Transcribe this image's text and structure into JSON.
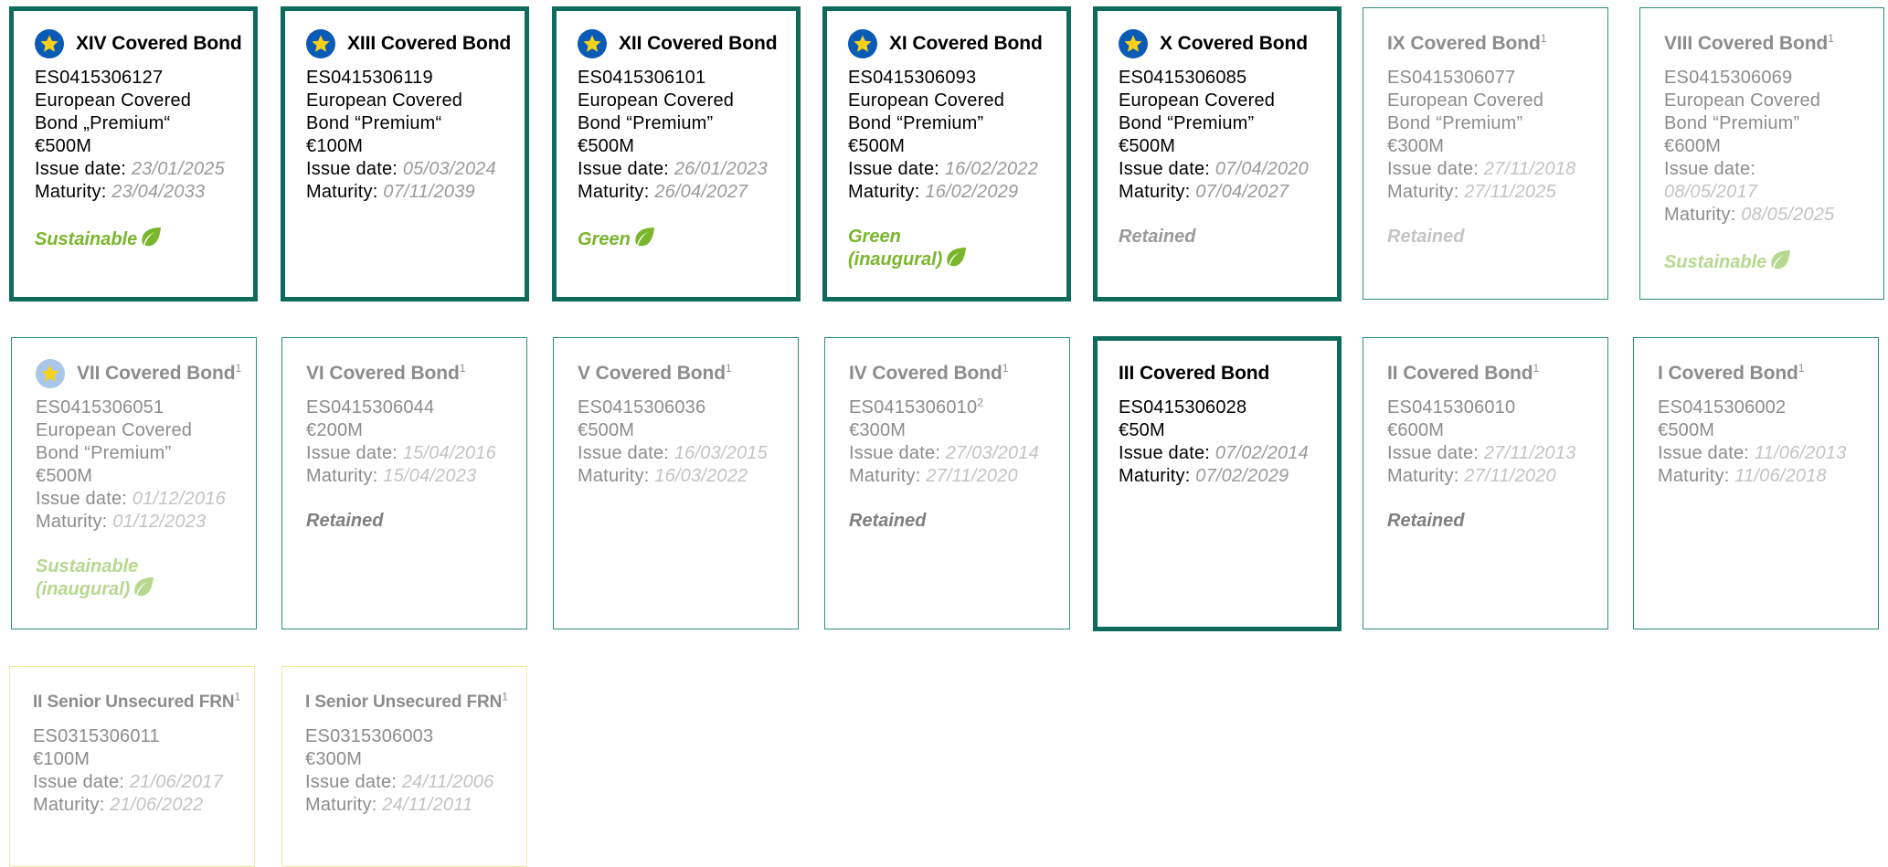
{
  "colors": {
    "active_border": "#0e6b5c",
    "faded_border": "#2b8f7f",
    "frn_border": "#f3e8a4",
    "green_tag": "#7ab62c",
    "star_badge": "#0a5bb6",
    "star": "#f7d117"
  },
  "labels": {
    "issue": "Issue date: ",
    "maturity": "Maturity: "
  },
  "row1": [
    {
      "title": "XIV Covered Bond",
      "isin": "ES0415306127",
      "desc1": "European Covered",
      "desc2": "Bond „Premium“",
      "amount": "€500M",
      "issue": "23/01/2025",
      "maturity": "23/04/2033",
      "tag": "Sustainable",
      "icon": "star-icon"
    },
    {
      "title": "XIII Covered Bond",
      "isin": "ES0415306119",
      "desc1": "European Covered",
      "desc2": "Bond “Premium“",
      "amount": "€100M",
      "issue": "05/03/2024",
      "maturity": "07/11/2039",
      "icon": "star-icon"
    },
    {
      "title": "XII Covered Bond",
      "isin": "ES0415306101",
      "desc1": "European Covered",
      "desc2": "Bond “Premium”",
      "amount": "€500M",
      "issue": "26/01/2023",
      "maturity": "26/04/2027",
      "tag": "Green",
      "icon": "star-icon"
    },
    {
      "title": "XI Covered Bond",
      "isin": "ES0415306093",
      "desc1": "European Covered",
      "desc2": "Bond “Premium”",
      "amount": "€500M",
      "issue": "16/02/2022",
      "maturity": "16/02/2029",
      "tag1": "Green",
      "tag2": "(inaugural)",
      "icon": "star-icon"
    },
    {
      "title": "X Covered Bond",
      "isin": "ES0415306085",
      "desc1": "European Covered",
      "desc2": "Bond “Premium”",
      "amount": "€500M",
      "issue": "07/04/2020",
      "maturity": "07/04/2027",
      "tag": "Retained",
      "icon": "star-icon"
    },
    {
      "title": "IX Covered Bond",
      "sup": "1",
      "isin": "ES0415306077",
      "desc1": "European Covered",
      "desc2": "Bond “Premium”",
      "amount": "€300M",
      "issue": "27/11/2018",
      "maturity": "27/11/2025",
      "tag": "Retained"
    },
    {
      "title": "VIII Covered Bond",
      "sup": "1",
      "isin": "ES0415306069",
      "desc1": "European Covered",
      "desc2": "Bond “Premium”",
      "amount": "€600M",
      "issue": "08/05/2017",
      "maturity": "08/05/2025",
      "tag": "Sustainable"
    }
  ],
  "row2": [
    {
      "title": "VII Covered Bond",
      "sup": "1",
      "isin": "ES0415306051",
      "desc1": "European Covered",
      "desc2": "Bond “Premium”",
      "amount": "€500M",
      "issue": "01/12/2016",
      "maturity": "01/12/2023",
      "tag1": "Sustainable",
      "tag2": "(inaugural)",
      "icon": "star-icon"
    },
    {
      "title": "VI Covered Bond",
      "sup": "1",
      "isin": "ES0415306044",
      "amount": "€200M",
      "issue": "15/04/2016",
      "maturity": "15/04/2023",
      "tag": "Retained"
    },
    {
      "title": "V Covered Bond",
      "sup": "1",
      "isin": "ES0415306036",
      "amount": "€500M",
      "issue": "16/03/2015",
      "maturity": "16/03/2022"
    },
    {
      "title": "IV Covered Bond",
      "sup": "1",
      "isin": "ES0415306010",
      "isin_sup": "2",
      "amount": "€300M",
      "issue": "27/03/2014",
      "maturity": "27/11/2020",
      "tag": "Retained"
    },
    {
      "title": "III Covered Bond",
      "isin": "ES0415306028",
      "amount": "€50M",
      "issue": "07/02/2014",
      "maturity": "07/02/2029"
    },
    {
      "title": "II Covered Bond",
      "sup": "1",
      "isin": "ES0415306010",
      "amount": "€600M",
      "issue": "27/11/2013",
      "maturity": "27/11/2020",
      "tag": "Retained"
    },
    {
      "title": "I Covered Bond",
      "sup": "1",
      "isin": "ES0415306002",
      "amount": "€500M",
      "issue": "11/06/2013",
      "maturity": "11/06/2018"
    }
  ],
  "row3": [
    {
      "title": "II Senior Unsecured FRN",
      "sup": "1",
      "isin": "ES0315306011",
      "amount": "€100M",
      "issue": "21/06/2017",
      "maturity": "21/06/2022"
    },
    {
      "title": "I Senior Unsecured FRN",
      "sup": "1",
      "isin": "ES0315306003",
      "amount": "€300M",
      "issue": "24/11/2006",
      "maturity": "24/11/2011"
    }
  ]
}
